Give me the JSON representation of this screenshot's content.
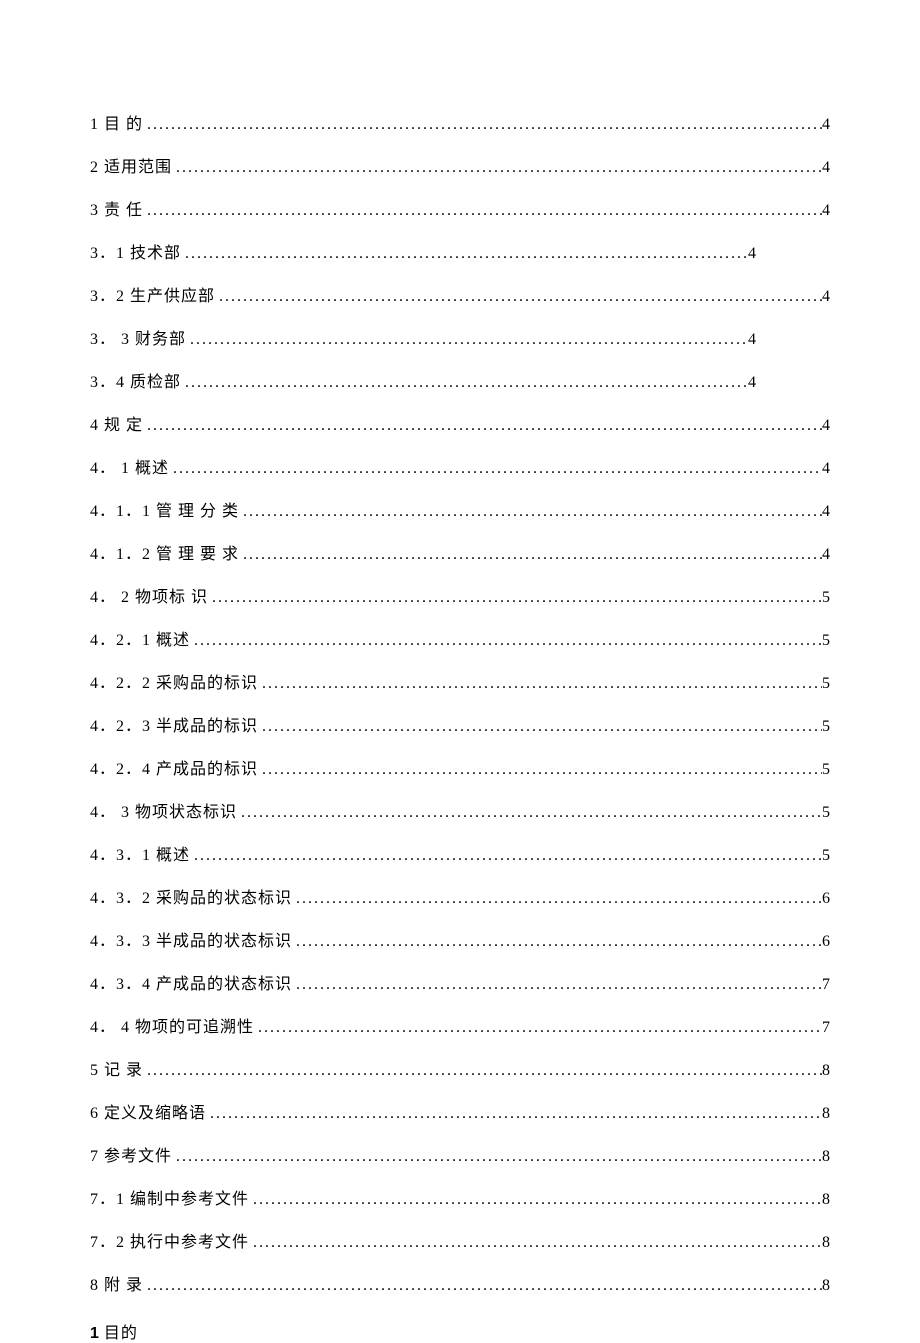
{
  "toc": [
    {
      "label": "1 目 的",
      "page": "4",
      "short": false
    },
    {
      "label": "2 适用范围",
      "page": "4",
      "short": false
    },
    {
      "label": "3 责 任",
      "page": "4",
      "short": false
    },
    {
      "label": "3．1 技术部",
      "page": "4",
      "short": true
    },
    {
      "label": "3．2 生产供应部",
      "page": "4",
      "short": false
    },
    {
      "label": "3． 3 财务部",
      "page": "4",
      "short": true
    },
    {
      "label": "3．4 质检部",
      "page": "4",
      "short": true
    },
    {
      "label": "4 规 定",
      "page": "4",
      "short": false
    },
    {
      "label": "4． 1 概述",
      "page": "4",
      "short": false
    },
    {
      "label": "4．1．1 管 理 分 类",
      "page": "4",
      "short": false
    },
    {
      "label": "4．1．2 管 理 要 求",
      "page": "4",
      "short": false
    },
    {
      "label": "4． 2 物项标 识",
      "page": "5",
      "short": false
    },
    {
      "label": "4．2．1 概述",
      "page": "5",
      "short": false
    },
    {
      "label": "4．2．2 采购品的标识",
      "page": "5",
      "short": false
    },
    {
      "label": "4．2．3 半成品的标识",
      "page": "5",
      "short": false
    },
    {
      "label": "4．2．4 产成品的标识",
      "page": "5",
      "short": false
    },
    {
      "label": "4． 3 物项状态标识",
      "page": "5",
      "short": false
    },
    {
      "label": "4．3．1 概述",
      "page": "5",
      "short": false
    },
    {
      "label": "4．3．2 采购品的状态标识",
      "page": "6",
      "short": false
    },
    {
      "label": "4．3．3 半成品的状态标识",
      "page": "6",
      "short": false
    },
    {
      "label": "4．3．4 产成品的状态标识",
      "page": "7",
      "short": false
    },
    {
      "label": "4． 4 物项的可追溯性",
      "page": "7",
      "short": false
    },
    {
      "label": "5 记 录",
      "page": "8",
      "short": false
    },
    {
      "label": "6 定义及缩略语",
      "page": "8",
      "short": false
    },
    {
      "label": "7 参考文件",
      "page": "8",
      "short": false
    },
    {
      "label": "7．1  编制中参考文件",
      "page": "8",
      "short": false
    },
    {
      "label": "7．2  执行中参考文件",
      "page": "8",
      "short": false
    },
    {
      "label": "8 附 录",
      "page": "8",
      "short": false
    }
  ],
  "heading": {
    "number": "1",
    "text": "目的"
  }
}
